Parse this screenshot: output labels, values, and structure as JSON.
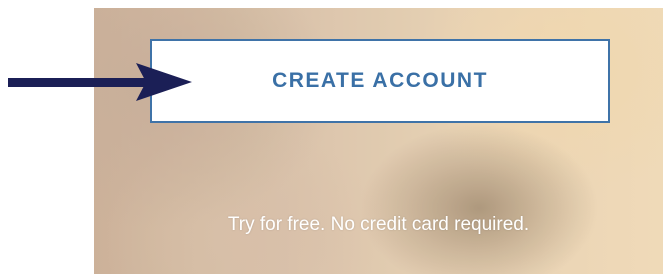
{
  "cta": {
    "button_label": "CREATE ACCOUNT",
    "tagline": "Try for free. No credit card required."
  },
  "annotation": {
    "arrow_icon": "right-arrow-icon",
    "arrow_color": "#1b1f56"
  },
  "colors": {
    "button_border": "#3f73a8",
    "button_text": "#3a70a6",
    "tagline_text": "#ffffff"
  }
}
